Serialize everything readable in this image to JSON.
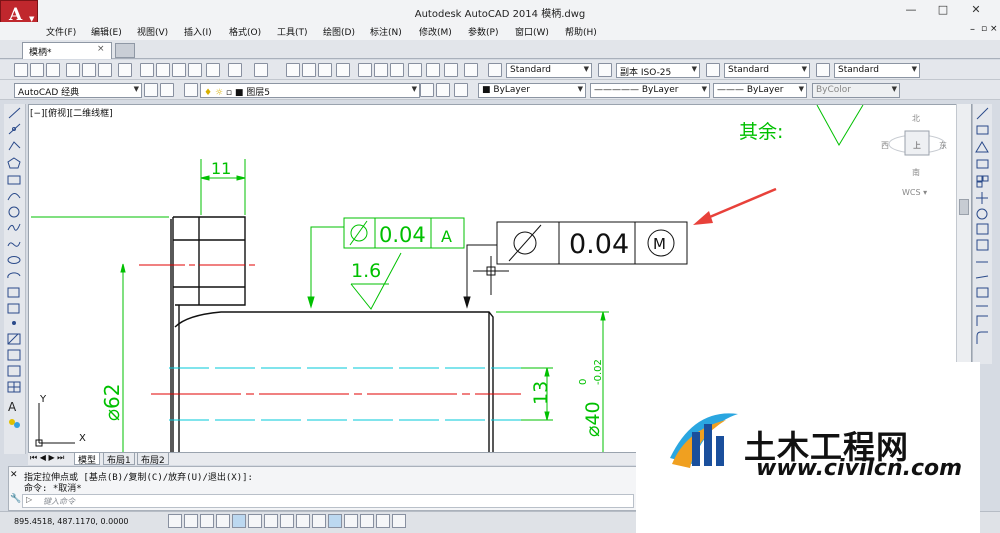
{
  "window": {
    "title": "Autodesk AutoCAD 2014    模柄.dwg",
    "controls": [
      "—",
      "□",
      "✕"
    ]
  },
  "menu": [
    "文件(F)",
    "编辑(E)",
    "视图(V)",
    "插入(I)",
    "格式(O)",
    "工具(T)",
    "绘图(D)",
    "标注(N)",
    "修改(M)",
    "参数(P)",
    "窗口(W)",
    "帮助(H)"
  ],
  "tabs": {
    "doc": "模柄*",
    "close": "×"
  },
  "toolbar1": {
    "text_style": "Standard",
    "dim_style": "副本 ISO-25",
    "table_style": "Standard",
    "mleader_style": "Standard"
  },
  "toolbar2": {
    "workspace": "AutoCAD 经典",
    "layer": "图层5",
    "color": "ByLayer",
    "linetype": "ByLayer",
    "lineweight": "ByLayer",
    "plotstyle": "ByColor"
  },
  "viewport": {
    "label": "[−][俯视][二维线框]",
    "viewcube": {
      "north": "北",
      "south": "南",
      "east": "东",
      "west": "西",
      "top": "上",
      "wcs": "WCS ▾"
    }
  },
  "drawing": {
    "dim_width": "11",
    "fcf_small": {
      "tolerance": "0.04",
      "datum": "A"
    },
    "fcf_large": {
      "tolerance": "0.04",
      "modifier": "M"
    },
    "roughness": "1.6",
    "qiyu": "其余:",
    "dim_dia62": "⌀62",
    "dim_13": "13",
    "dim_dia40": "⌀40",
    "dim_tol_upper": "0",
    "dim_tol_lower": "-0.02",
    "ucs_x": "X",
    "ucs_y": "Y"
  },
  "layout_tabs": [
    "模型",
    "布局1",
    "布局2"
  ],
  "command": {
    "line1": "指定拉伸点或 [基点(B)/复制(C)/放弃(U)/退出(X)]:",
    "line2": "命令: *取消*",
    "placeholder": "键入命令"
  },
  "status": {
    "coords": "895.4518,  487.1170,  0.0000"
  },
  "watermark": {
    "title": "土木工程网",
    "url": "www.civilcn.com"
  },
  "colors": {
    "green": "#00c000",
    "cyan": "#00c8d8",
    "red": "#e00000",
    "autocad_red": "#c0272d",
    "arrow_red": "#e8413a"
  }
}
